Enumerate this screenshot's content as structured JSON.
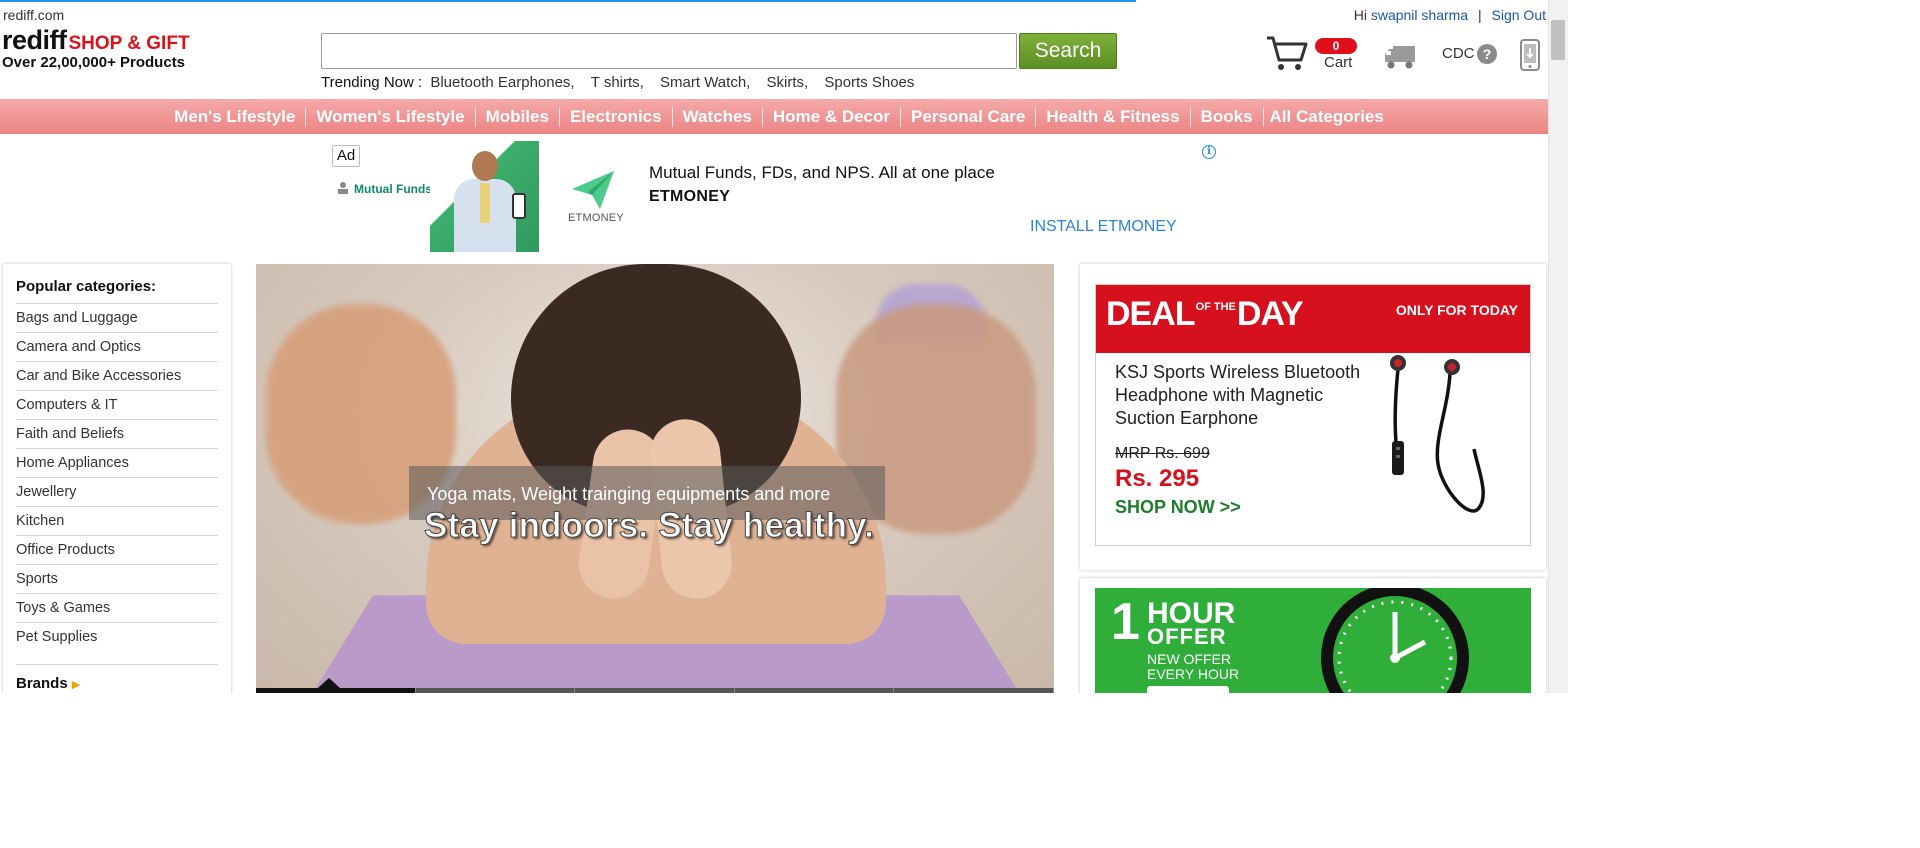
{
  "header": {
    "site_name": "rediff.com",
    "logo_brand": "rediff",
    "logo_tagline": "SHOP & GIFT",
    "product_count": "Over 22,00,000+ Products",
    "search_value": "",
    "search_button": "Search",
    "trending_label": "Trending Now :",
    "trending": [
      "Bluetooth Earphones,",
      "T shirts,",
      "Smart Watch,",
      "Skirts,",
      "Sports Shoes"
    ],
    "greeting_hi": "Hi",
    "username": "swapnil sharma",
    "separator": "|",
    "sign_out": "Sign Out",
    "cart_count": "0",
    "cart_label": "Cart",
    "cdc_label": "CDC",
    "help_glyph": "?"
  },
  "nav": {
    "items": [
      "Men's Lifestyle",
      "Women's Lifestyle",
      "Mobiles",
      "Electronics",
      "Watches",
      "Home & Decor",
      "Personal Care",
      "Health & Fitness",
      "Books",
      "All Categories"
    ]
  },
  "ad": {
    "badge": "Ad",
    "mf_label": "Mutual Funds",
    "etmoney_label": "ETMONEY",
    "headline": "Mutual Funds, FDs, and NPS. All at one place",
    "brand": "ETMONEY",
    "cta": "INSTALL ETMONEY",
    "info_glyph": "i"
  },
  "categories": {
    "title": "Popular categories:",
    "items": [
      "Bags and Luggage",
      "Camera and Optics",
      "Car and Bike Accessories",
      "Computers & IT",
      "Faith and Beliefs",
      "Home Appliances",
      "Jewellery",
      "Kitchen",
      "Office Products",
      "Sports",
      "Toys & Games",
      "Pet Supplies"
    ],
    "brands_label": "Brands",
    "brands_arrow": "▶"
  },
  "hero": {
    "subtitle": "Yoga mats, Weight trainging equipments and more",
    "title": "Stay indoors. Stay healthy."
  },
  "deal": {
    "logo_deal": "DEAL",
    "logo_of": "OF THE",
    "logo_day": "DAY",
    "only_today": "ONLY FOR TODAY",
    "product_name": "KSJ Sports Wireless Bluetooth Headphone with Magnetic Suction Earphone",
    "mrp": "MRP Rs. 699",
    "price": "Rs. 295",
    "shop_now": "SHOP NOW >>"
  },
  "hour_offer": {
    "number": "1",
    "title": "HOUR",
    "offer": "OFFER",
    "line1": "NEW OFFER",
    "line2": "EVERY HOUR"
  },
  "colors": {
    "nav_bg": "#ec8484",
    "brand_red": "#e0101a",
    "search_green": "#6aa02c",
    "link_blue": "#1a56b4",
    "deal_red": "#d7101e",
    "offer_green": "#2fae3a"
  }
}
